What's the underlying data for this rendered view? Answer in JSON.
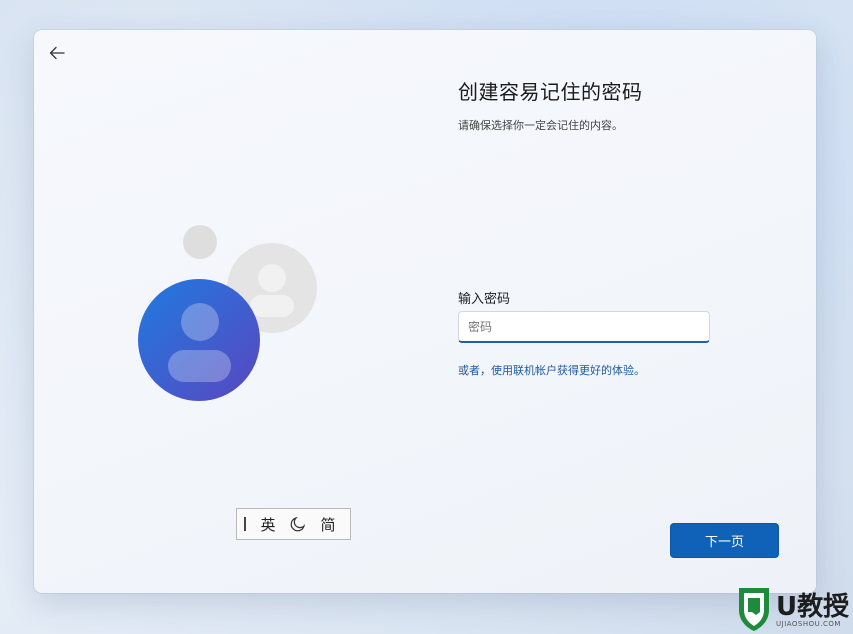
{
  "page": {
    "title": "创建容易记住的密码",
    "subtitle": "请确保选择你一定会记住的内容。"
  },
  "form": {
    "label": "输入密码",
    "placeholder": "密码",
    "value": ""
  },
  "alt_option": "或者，使用联机帐户获得更好的体验。",
  "next_button": "下一页",
  "ime": {
    "mode": "英",
    "charset": "简"
  },
  "icons": {
    "back": "back-arrow-icon",
    "avatar": "user-avatar-icon",
    "moon": "half-width-moon-icon"
  },
  "colors": {
    "accent": "#0f62b7",
    "link": "#1e5aa0",
    "avatar_blue": "#2f6fd1",
    "avatar_purple": "#5b4fc4"
  },
  "watermark": {
    "brand": "U教授",
    "url": "UJIAOSHOU.COM"
  }
}
